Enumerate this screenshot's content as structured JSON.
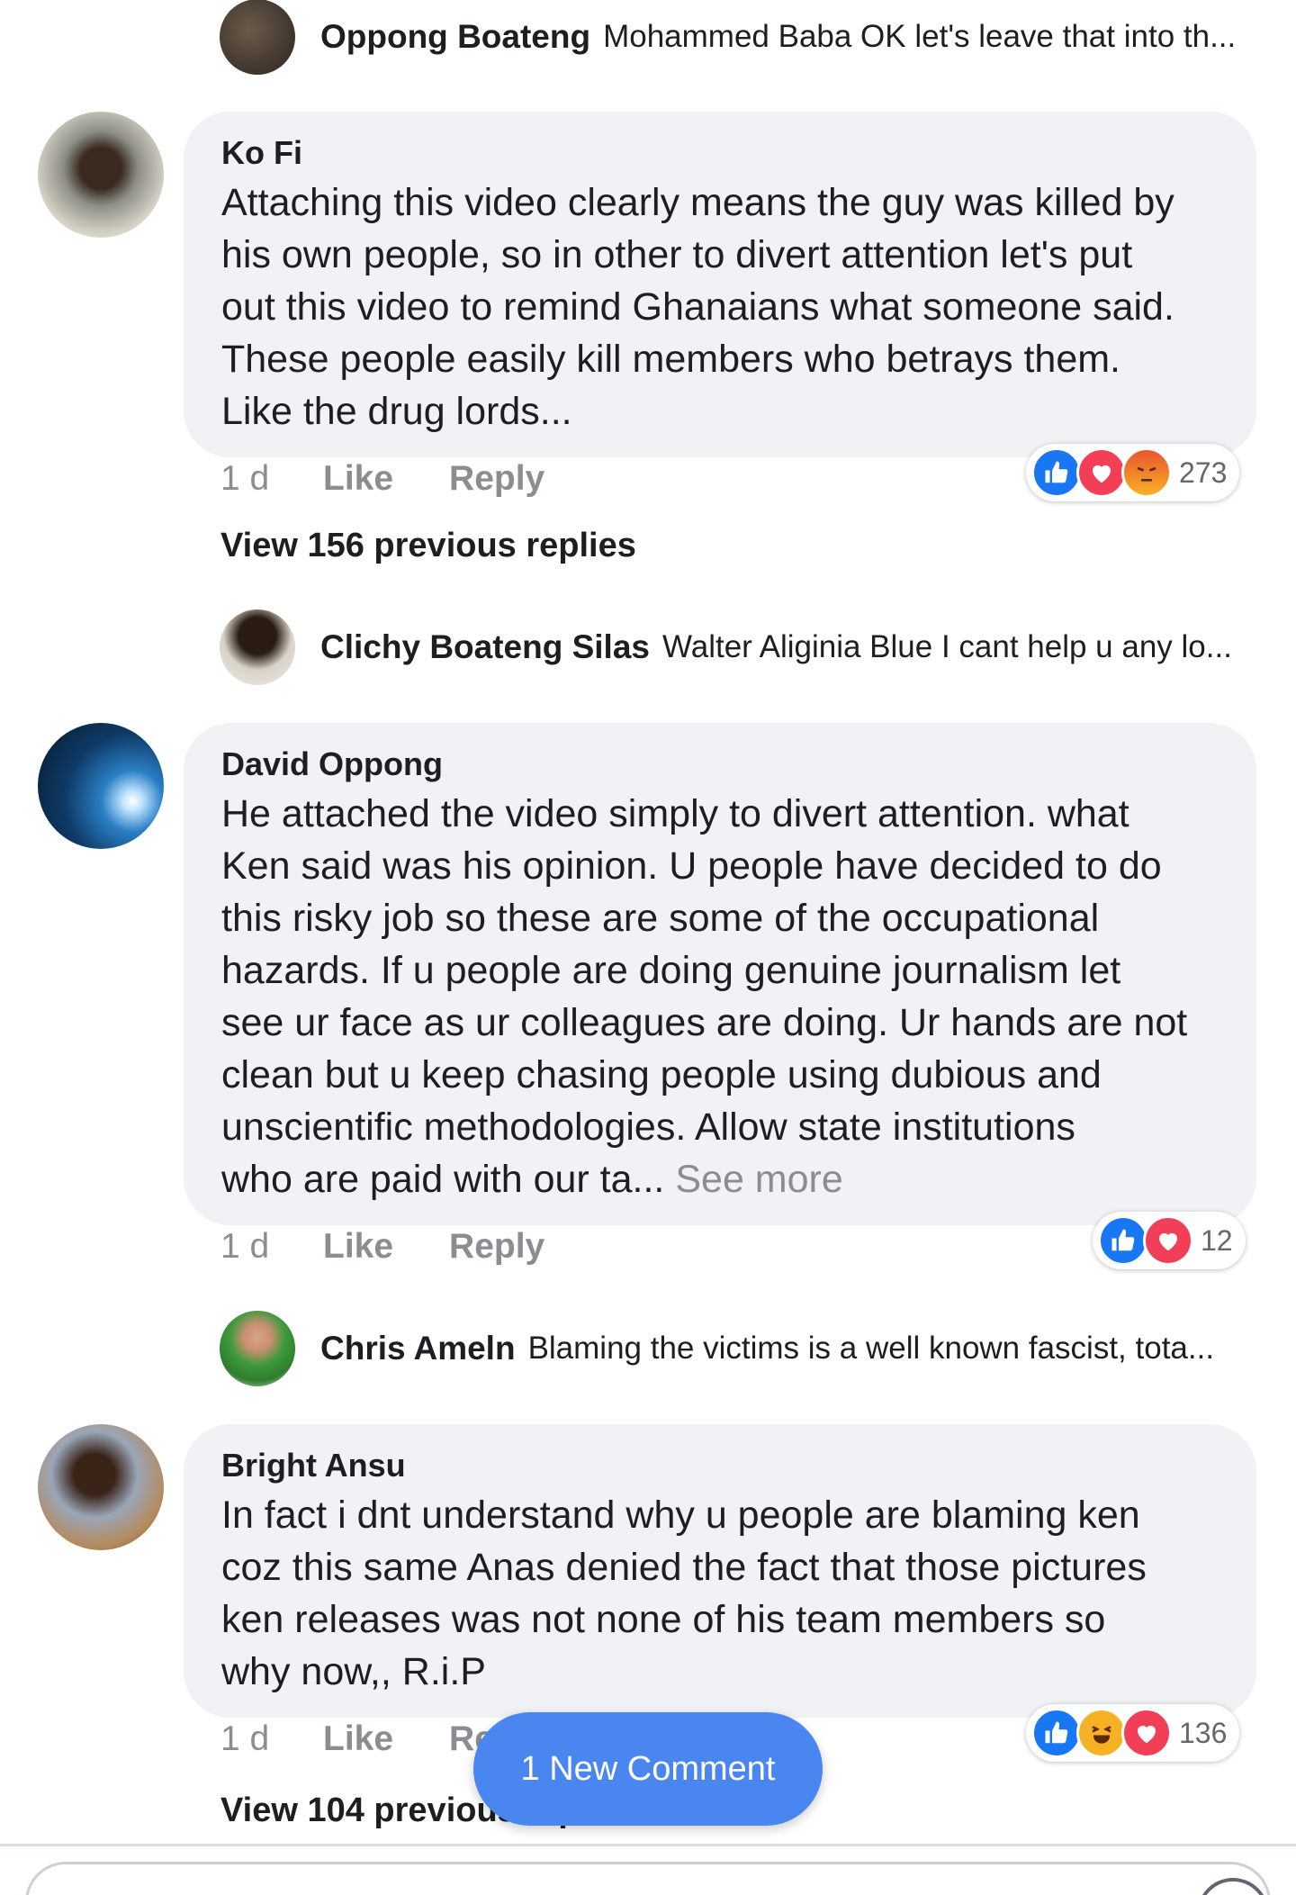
{
  "colors": {
    "like": "#1877f2",
    "love": "#f33e58",
    "angry": "#f7b125",
    "haha": "#f7b125",
    "new_comment_bg": "#4a86f0",
    "bubble_bg": "#f0f2f5"
  },
  "reply_previews": [
    {
      "name": "Oppong Boateng",
      "text": "Mohammed Baba OK let's leave that into th..."
    },
    {
      "name": "Clichy Boateng Silas",
      "text": "Walter Aliginia Blue  I cant help u any lo..."
    },
    {
      "name": "Chris Ameln",
      "text": "Blaming the victims is a well known fascist, tota..."
    }
  ],
  "comments": [
    {
      "author": "Ko Fi",
      "lines": [
        "Attaching this video clearly means the guy was killed by",
        "his own people, so in other to divert attention let's put",
        "out this video to remind Ghanaians what someone said.",
        "These people easily kill members who betrays them.",
        "Like the drug lords..."
      ],
      "time": "1 d",
      "like": "Like",
      "reply": "Reply",
      "reactions": [
        "like-icon",
        "love-icon",
        "angry-icon"
      ],
      "reaction_count": "273",
      "view_previous": "View 156 previous replies"
    },
    {
      "author": "David Oppong",
      "lines": [
        "He attached the video simply to divert attention. what",
        "Ken said was his opinion. U people have decided to do",
        "this risky job so these are some of the occupational",
        "hazards. If u people are doing genuine journalism let",
        "see ur face as ur colleagues are doing. Ur hands are not",
        "clean but u keep chasing people using dubious and",
        "unscientific methodologies. Allow state institutions"
      ],
      "last_line": "who are paid with our ta...",
      "see_more": "See more",
      "time": "1 d",
      "like": "Like",
      "reply": "Reply",
      "reactions": [
        "like-icon",
        "love-icon"
      ],
      "reaction_count": "12"
    },
    {
      "author": "Bright Ansu",
      "lines": [
        "In fact i dnt understand why u people are blaming ken",
        "coz this same Anas denied the fact that those pictures",
        "ken releases was not none of his team members so",
        "why now,, R.i.P"
      ],
      "time": "1 d",
      "like": "Like",
      "reply": "Reply",
      "reactions": [
        "like-icon",
        "haha-icon",
        "love-icon"
      ],
      "reaction_count": "136",
      "view_previous": "View 104 previous replies"
    }
  ],
  "new_comment_label": "1 New Comment"
}
